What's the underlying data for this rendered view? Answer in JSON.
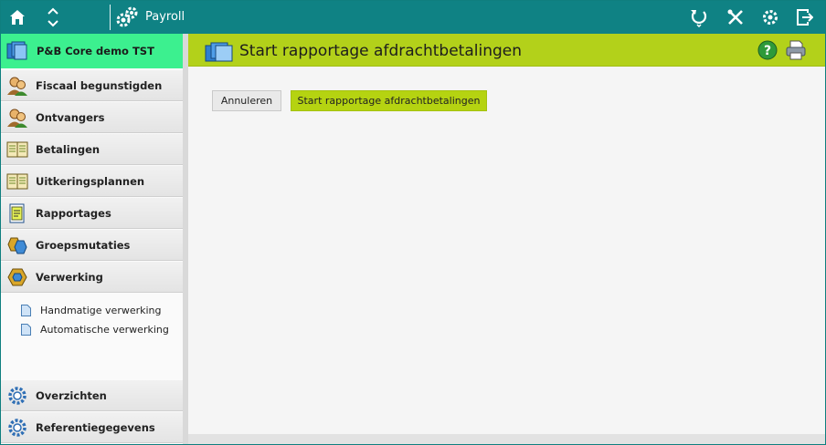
{
  "topbar": {
    "app_title": "Payroll",
    "icons": [
      "home-icon",
      "collapse-arrows-icon",
      "gears-logo-icon",
      "refresh-icon",
      "tools-icon",
      "settings-icon",
      "logout-icon"
    ]
  },
  "sidebar": {
    "company": "P&B Core demo TST",
    "items": [
      {
        "label": "Fiscaal begunstigden",
        "icon": "people-icon"
      },
      {
        "label": "Ontvangers",
        "icon": "people-icon"
      },
      {
        "label": "Betalingen",
        "icon": "ledger-book-icon"
      },
      {
        "label": "Uitkeringsplannen",
        "icon": "ledger-book-icon"
      },
      {
        "label": "Rapportages",
        "icon": "report-icon"
      },
      {
        "label": "Groepsmutaties",
        "icon": "hexagon-group-icon"
      },
      {
        "label": "Verwerking",
        "icon": "hexagon-icon"
      }
    ],
    "subitems": [
      {
        "label": "Handmatige verwerking",
        "icon": "document-icon"
      },
      {
        "label": "Automatische verwerking",
        "icon": "document-icon"
      }
    ],
    "bottom_items": [
      {
        "label": "Overzichten",
        "icon": "gear-icon"
      },
      {
        "label": "Referentiegegevens",
        "icon": "gear-icon"
      }
    ]
  },
  "main": {
    "title": "Start rapportage afdrachtbetalingen",
    "buttons": {
      "cancel": "Annuleren",
      "start": "Start rapportage afdrachtbetalingen"
    },
    "header_icons": [
      "help-icon",
      "print-icon"
    ]
  },
  "colors": {
    "topbar": "#0f8284",
    "company_bg": "#3cf08f",
    "header_bg": "#b3d11a",
    "start_button": "#b5d311"
  }
}
